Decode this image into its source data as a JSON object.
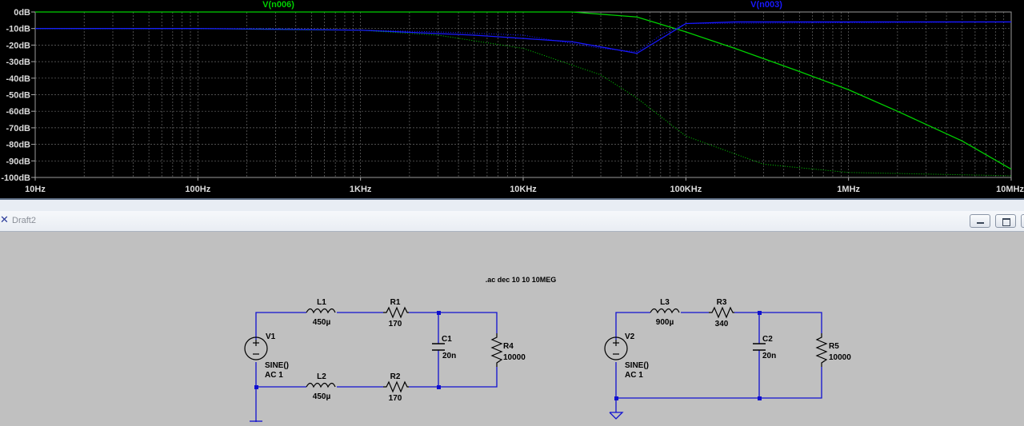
{
  "plot": {
    "traces": [
      {
        "name": "V(n006)",
        "color": "#00d000"
      },
      {
        "name": "V(n003)",
        "color": "#1818ff"
      }
    ],
    "y_ticks": [
      "0dB",
      "-10dB",
      "-20dB",
      "-30dB",
      "-40dB",
      "-50dB",
      "-60dB",
      "-70dB",
      "-80dB",
      "-90dB",
      "-100dB"
    ],
    "x_ticks": [
      "10Hz",
      "100Hz",
      "1KHz",
      "10KHz",
      "100KHz",
      "1MHz",
      "10MHz"
    ]
  },
  "chart_data": [
    {
      "type": "line",
      "title": "",
      "xlabel": "",
      "ylabel": "",
      "x_scale": "log",
      "xlim": [
        "10Hz",
        "10MHz"
      ],
      "ylim": [
        -100,
        0
      ],
      "grid": true,
      "x": [
        10,
        100,
        1000,
        5000,
        10000,
        20000,
        50000,
        100000,
        200000,
        500000,
        1000000,
        2000000,
        5000000,
        10000000
      ],
      "series": [
        {
          "name": "V(n006)",
          "values": [
            0,
            0,
            0,
            0,
            0,
            0,
            -3,
            -12,
            -22,
            -36,
            -47,
            -60,
            -78,
            -95
          ]
        },
        {
          "name": "V(n003)",
          "values": [
            -10,
            -10,
            -11,
            -14,
            -16,
            -18,
            -25,
            -7,
            -6,
            -6,
            -6,
            -6,
            -6,
            -6
          ]
        }
      ]
    }
  ],
  "window": {
    "title": "Draft2",
    "buttons": [
      "minimize",
      "restore",
      "close"
    ]
  },
  "schematic": {
    "directive": ".ac dec 10 10 10MEG",
    "circuit1": {
      "L1": {
        "name": "L1",
        "value": "450µ"
      },
      "L2": {
        "name": "L2",
        "value": "450µ"
      },
      "R1": {
        "name": "R1",
        "value": "170"
      },
      "R2": {
        "name": "R2",
        "value": "170"
      },
      "C1": {
        "name": "C1",
        "value": "20n"
      },
      "R4": {
        "name": "R4",
        "value": "10000"
      },
      "V1": {
        "name": "V1",
        "value1": "SINE()",
        "value2": "AC 1"
      }
    },
    "circuit2": {
      "L3": {
        "name": "L3",
        "value": "900µ"
      },
      "R3": {
        "name": "R3",
        "value": "340"
      },
      "C2": {
        "name": "C2",
        "value": "20n"
      },
      "R5": {
        "name": "R5",
        "value": "10000"
      },
      "V2": {
        "name": "V2",
        "value1": "SINE()",
        "value2": "AC 1"
      }
    }
  }
}
